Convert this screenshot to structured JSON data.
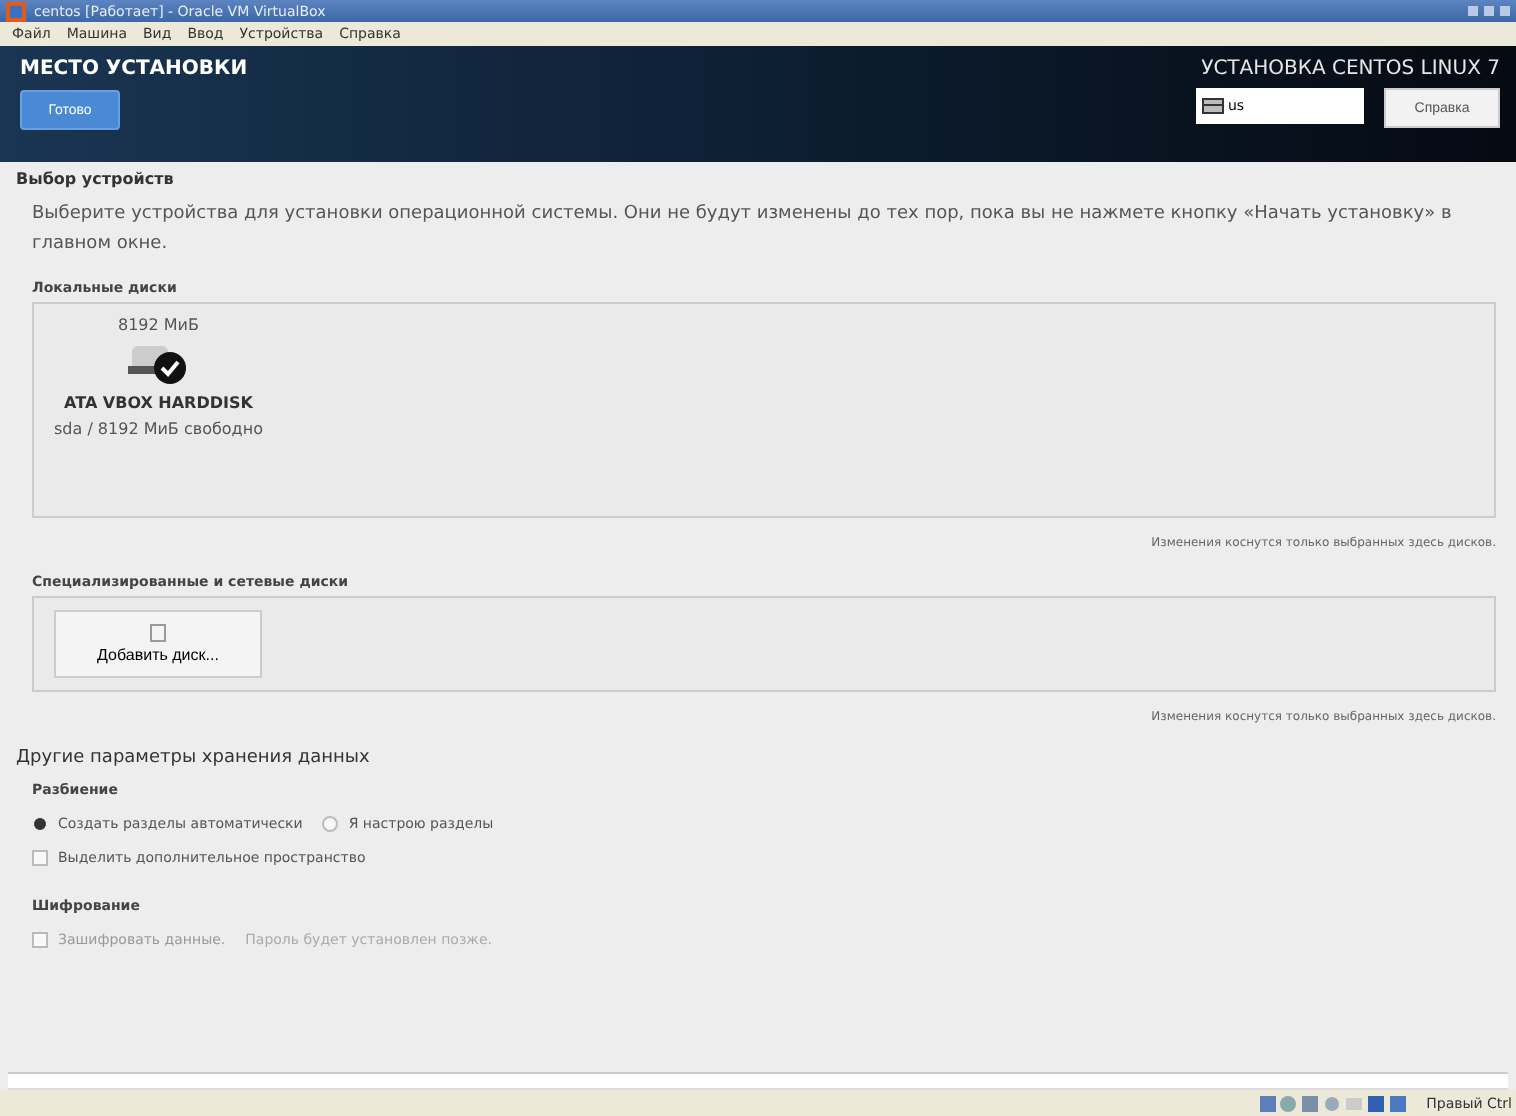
{
  "window": {
    "title": "centos [Работает] - Oracle VM VirtualBox"
  },
  "menu": [
    "Файл",
    "Машина",
    "Вид",
    "Ввод",
    "Устройства",
    "Справка"
  ],
  "header": {
    "title": "МЕСТО УСТАНОВКИ",
    "done_button": "Готово",
    "product": "УСТАНОВКА CENTOS LINUX 7",
    "keyboard": "us",
    "help_button": "Справка"
  },
  "device_selection": {
    "heading": "Выбор устройств",
    "description": "Выберите устройства для установки операционной системы. Они не будут изменены до тех пор, пока вы не нажмете кнопку «Начать установку» в главном окне.",
    "local_disks": {
      "label": "Локальные диски",
      "disks": [
        {
          "size": "8192 МиБ",
          "name": "ATA VBOX HARDDISK",
          "free": "sda / 8192 МиБ свободно",
          "selected": true
        }
      ],
      "note": "Изменения коснутся только выбранных здесь дисков."
    },
    "network_disks": {
      "label": "Специализированные и сетевые диски",
      "add_button": "Добавить диск...",
      "note": "Изменения коснутся только выбранных здесь дисков."
    }
  },
  "other_options": {
    "heading": "Другие параметры хранения данных",
    "partitioning": {
      "label": "Разбиение",
      "options": [
        {
          "label": "Создать разделы автоматически",
          "selected": true
        },
        {
          "label": "Я настрою разделы",
          "selected": false
        }
      ],
      "reclaim": {
        "label": "Выделить дополнительное пространство",
        "checked": false
      }
    },
    "encryption": {
      "label": "Шифрование",
      "encrypt": {
        "label": "Зашифровать данные.",
        "checked": false,
        "disabled": true
      },
      "hint": "Пароль будет установлен позже."
    }
  },
  "status_bar": {
    "host_key": "Правый Ctrl"
  }
}
